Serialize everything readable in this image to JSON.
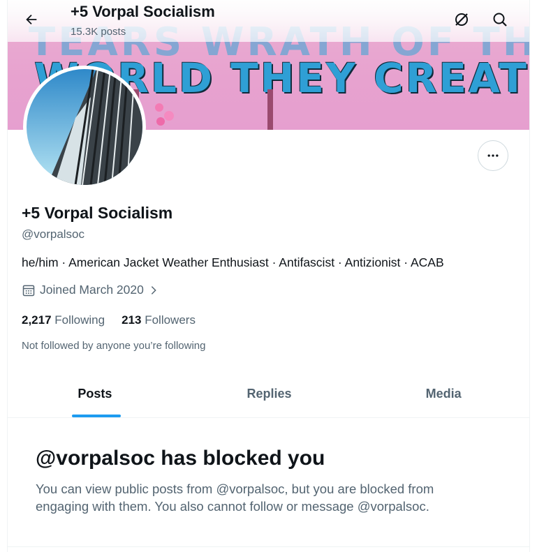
{
  "header": {
    "title": "+5 Vorpal Socialism",
    "post_count": "15.3K posts"
  },
  "banner": {
    "text_top": "TEARS WRATH OF THE",
    "text": "WORLD THEY CREATED."
  },
  "profile": {
    "display_name": "+5 Vorpal Socialism",
    "handle": "@vorpalsoc",
    "bio": "he/him · American Jacket Weather Enthusiast · Antifascist · Antizionist · ACAB",
    "joined": "Joined March 2020",
    "following_count": "2,217",
    "following_label": "Following",
    "followers_count": "213",
    "followers_label": "Followers",
    "not_followed_text": "Not followed by anyone you’re following"
  },
  "tabs": [
    {
      "label": "Posts",
      "active": true
    },
    {
      "label": "Replies",
      "active": false
    },
    {
      "label": "Media",
      "active": false
    }
  ],
  "blocked": {
    "title": "@vorpalsoc has blocked you",
    "message": "You can view public posts from @vorpalsoc, but you are blocked from engaging with them. You also cannot follow or message @vorpalsoc."
  },
  "colors": {
    "accent": "#1d9bf0",
    "text_primary": "#0f1419",
    "text_secondary": "#536471",
    "border": "#eff3f4"
  },
  "icons": [
    "back-arrow-icon",
    "grok-icon",
    "search-icon",
    "more-icon",
    "calendar-icon",
    "chevron-right-icon"
  ]
}
